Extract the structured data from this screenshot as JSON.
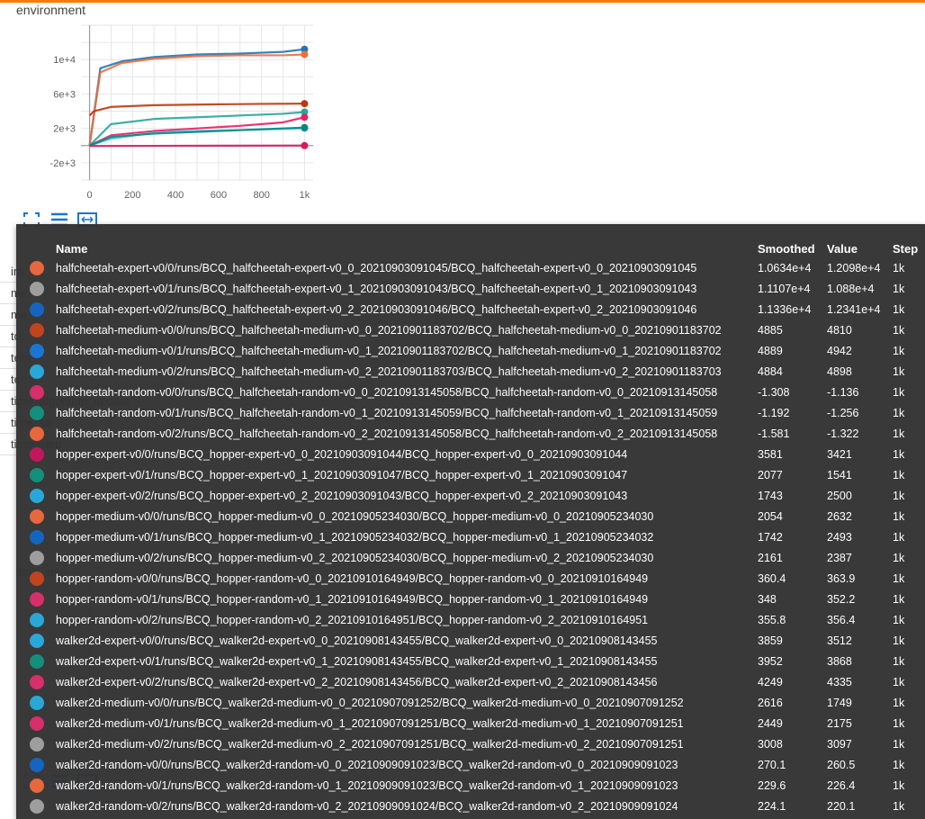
{
  "chart_data": {
    "type": "line",
    "title": "environment",
    "xlabel": "",
    "ylabel": "",
    "x_ticks": [
      "0",
      "200",
      "400",
      "600",
      "800",
      "1k"
    ],
    "y_ticks": [
      "-2e+3",
      "2e+3",
      "6e+3",
      "1e+4"
    ],
    "xlim": [
      -40,
      1040
    ],
    "ylim": [
      -4000,
      14000
    ],
    "grid": true,
    "series": [
      {
        "color": "#1f77b4",
        "values": [
          [
            0,
            0
          ],
          [
            50,
            9000
          ],
          [
            150,
            9800
          ],
          [
            300,
            10300
          ],
          [
            500,
            10600
          ],
          [
            700,
            10700
          ],
          [
            900,
            10900
          ],
          [
            1000,
            11200
          ]
        ]
      },
      {
        "color": "#ef6c3c",
        "values": [
          [
            0,
            0
          ],
          [
            50,
            8500
          ],
          [
            150,
            9600
          ],
          [
            300,
            10100
          ],
          [
            500,
            10400
          ],
          [
            700,
            10500
          ],
          [
            900,
            10500
          ],
          [
            1000,
            10600
          ]
        ]
      },
      {
        "color": "#bf360c",
        "values": [
          [
            0,
            3500
          ],
          [
            20,
            4000
          ],
          [
            100,
            4500
          ],
          [
            300,
            4700
          ],
          [
            600,
            4800
          ],
          [
            800,
            4850
          ],
          [
            1000,
            4880
          ]
        ]
      },
      {
        "color": "#26a69a",
        "values": [
          [
            0,
            0
          ],
          [
            100,
            2500
          ],
          [
            300,
            3100
          ],
          [
            500,
            3300
          ],
          [
            700,
            3500
          ],
          [
            900,
            3700
          ],
          [
            1000,
            3900
          ]
        ]
      },
      {
        "color": "#e91e63",
        "values": [
          [
            0,
            0
          ],
          [
            100,
            1200
          ],
          [
            300,
            1700
          ],
          [
            500,
            2000
          ],
          [
            700,
            2300
          ],
          [
            900,
            2700
          ],
          [
            1000,
            3300
          ]
        ]
      },
      {
        "color": "#4fc3f7",
        "values": [
          [
            0,
            0
          ],
          [
            100,
            800
          ],
          [
            300,
            1500
          ],
          [
            500,
            1700
          ],
          [
            700,
            1800
          ],
          [
            1000,
            2000
          ]
        ]
      },
      {
        "color": "#00897b",
        "values": [
          [
            0,
            0
          ],
          [
            100,
            1000
          ],
          [
            300,
            1400
          ],
          [
            500,
            1600
          ],
          [
            700,
            1800
          ],
          [
            1000,
            2100
          ]
        ]
      },
      {
        "color": "#d81b60",
        "values": [
          [
            0,
            -50
          ],
          [
            300,
            -30
          ],
          [
            600,
            -10
          ],
          [
            1000,
            -1
          ]
        ]
      }
    ]
  },
  "background": {
    "run_rows": [
      "im",
      "me",
      "me",
      "td",
      "tem",
      "ter",
      "time_algorithm_update",
      "time_sa",
      "time_step"
    ],
    "section_label": "time_step"
  },
  "tooltip": {
    "headers": {
      "name": "Name",
      "smoothed": "Smoothed",
      "value": "Value",
      "step": "Step"
    },
    "rows": [
      {
        "color": "#e8673c",
        "name": "halfcheetah-expert-v0/0/runs/BCQ_halfcheetah-expert-v0_0_20210903091045/BCQ_halfcheetah-expert-v0_0_20210903091045",
        "smoothed": "1.0634e+4",
        "value": "1.2098e+4",
        "step": "1k"
      },
      {
        "color": "#9e9e9e",
        "name": "halfcheetah-expert-v0/1/runs/BCQ_halfcheetah-expert-v0_1_20210903091043/BCQ_halfcheetah-expert-v0_1_20210903091043",
        "smoothed": "1.1107e+4",
        "value": "1.088e+4",
        "step": "1k"
      },
      {
        "color": "#1565c0",
        "name": "halfcheetah-expert-v0/2/runs/BCQ_halfcheetah-expert-v0_2_20210903091046/BCQ_halfcheetah-expert-v0_2_20210903091046",
        "smoothed": "1.1336e+4",
        "value": "1.2341e+4",
        "step": "1k"
      },
      {
        "color": "#c1441e",
        "name": "halfcheetah-medium-v0/0/runs/BCQ_halfcheetah-medium-v0_0_20210901183702/BCQ_halfcheetah-medium-v0_0_20210901183702",
        "smoothed": "4885",
        "value": "4810",
        "step": "1k"
      },
      {
        "color": "#1976d2",
        "name": "halfcheetah-medium-v0/1/runs/BCQ_halfcheetah-medium-v0_1_20210901183702/BCQ_halfcheetah-medium-v0_1_20210901183702",
        "smoothed": "4889",
        "value": "4942",
        "step": "1k"
      },
      {
        "color": "#29a8d8",
        "name": "halfcheetah-medium-v0/2/runs/BCQ_halfcheetah-medium-v0_2_20210901183703/BCQ_halfcheetah-medium-v0_2_20210901183703",
        "smoothed": "4884",
        "value": "4898",
        "step": "1k"
      },
      {
        "color": "#d62f6b",
        "name": "halfcheetah-random-v0/0/runs/BCQ_halfcheetah-random-v0_0_20210913145058/BCQ_halfcheetah-random-v0_0_20210913145058",
        "smoothed": "-1.308",
        "value": "-1.136",
        "step": "1k"
      },
      {
        "color": "#138f7c",
        "name": "halfcheetah-random-v0/1/runs/BCQ_halfcheetah-random-v0_1_20210913145059/BCQ_halfcheetah-random-v0_1_20210913145059",
        "smoothed": "-1.192",
        "value": "-1.256",
        "step": "1k"
      },
      {
        "color": "#e8673c",
        "name": "halfcheetah-random-v0/2/runs/BCQ_halfcheetah-random-v0_2_20210913145058/BCQ_halfcheetah-random-v0_2_20210913145058",
        "smoothed": "-1.581",
        "value": "-1.322",
        "step": "1k"
      },
      {
        "color": "#c2185b",
        "name": "hopper-expert-v0/0/runs/BCQ_hopper-expert-v0_0_20210903091044/BCQ_hopper-expert-v0_0_20210903091044",
        "smoothed": "3581",
        "value": "3421",
        "step": "1k"
      },
      {
        "color": "#138f7c",
        "name": "hopper-expert-v0/1/runs/BCQ_hopper-expert-v0_1_20210903091047/BCQ_hopper-expert-v0_1_20210903091047",
        "smoothed": "2077",
        "value": "1541",
        "step": "1k"
      },
      {
        "color": "#29a8d8",
        "name": "hopper-expert-v0/2/runs/BCQ_hopper-expert-v0_2_20210903091043/BCQ_hopper-expert-v0_2_20210903091043",
        "smoothed": "1743",
        "value": "2500",
        "step": "1k"
      },
      {
        "color": "#e8673c",
        "name": "hopper-medium-v0/0/runs/BCQ_hopper-medium-v0_0_20210905234030/BCQ_hopper-medium-v0_0_20210905234030",
        "smoothed": "2054",
        "value": "2632",
        "step": "1k"
      },
      {
        "color": "#1565c0",
        "name": "hopper-medium-v0/1/runs/BCQ_hopper-medium-v0_1_20210905234032/BCQ_hopper-medium-v0_1_20210905234032",
        "smoothed": "1742",
        "value": "2493",
        "step": "1k"
      },
      {
        "color": "#9e9e9e",
        "name": "hopper-medium-v0/2/runs/BCQ_hopper-medium-v0_2_20210905234030/BCQ_hopper-medium-v0_2_20210905234030",
        "smoothed": "2161",
        "value": "2387",
        "step": "1k"
      },
      {
        "color": "#c1441e",
        "name": "hopper-random-v0/0/runs/BCQ_hopper-random-v0_0_20210910164949/BCQ_hopper-random-v0_0_20210910164949",
        "smoothed": "360.4",
        "value": "363.9",
        "step": "1k"
      },
      {
        "color": "#d62f6b",
        "name": "hopper-random-v0/1/runs/BCQ_hopper-random-v0_1_20210910164949/BCQ_hopper-random-v0_1_20210910164949",
        "smoothed": "348",
        "value": "352.2",
        "step": "1k"
      },
      {
        "color": "#29a8d8",
        "name": "hopper-random-v0/2/runs/BCQ_hopper-random-v0_2_20210910164951/BCQ_hopper-random-v0_2_20210910164951",
        "smoothed": "355.8",
        "value": "356.4",
        "step": "1k"
      },
      {
        "color": "#29a8d8",
        "name": "walker2d-expert-v0/0/runs/BCQ_walker2d-expert-v0_0_20210908143455/BCQ_walker2d-expert-v0_0_20210908143455",
        "smoothed": "3859",
        "value": "3512",
        "step": "1k"
      },
      {
        "color": "#138f7c",
        "name": "walker2d-expert-v0/1/runs/BCQ_walker2d-expert-v0_1_20210908143455/BCQ_walker2d-expert-v0_1_20210908143455",
        "smoothed": "3952",
        "value": "3868",
        "step": "1k"
      },
      {
        "color": "#d62f6b",
        "name": "walker2d-expert-v0/2/runs/BCQ_walker2d-expert-v0_2_20210908143456/BCQ_walker2d-expert-v0_2_20210908143456",
        "smoothed": "4249",
        "value": "4335",
        "step": "1k"
      },
      {
        "color": "#29a8d8",
        "name": "walker2d-medium-v0/0/runs/BCQ_walker2d-medium-v0_0_20210907091252/BCQ_walker2d-medium-v0_0_20210907091252",
        "smoothed": "2616",
        "value": "1749",
        "step": "1k"
      },
      {
        "color": "#d62f6b",
        "name": "walker2d-medium-v0/1/runs/BCQ_walker2d-medium-v0_1_20210907091251/BCQ_walker2d-medium-v0_1_20210907091251",
        "smoothed": "2449",
        "value": "2175",
        "step": "1k"
      },
      {
        "color": "#9e9e9e",
        "name": "walker2d-medium-v0/2/runs/BCQ_walker2d-medium-v0_2_20210907091251/BCQ_walker2d-medium-v0_2_20210907091251",
        "smoothed": "3008",
        "value": "3097",
        "step": "1k"
      },
      {
        "color": "#1565c0",
        "name": "walker2d-random-v0/0/runs/BCQ_walker2d-random-v0_0_20210909091023/BCQ_walker2d-random-v0_0_20210909091023",
        "smoothed": "270.1",
        "value": "260.5",
        "step": "1k"
      },
      {
        "color": "#e8673c",
        "name": "walker2d-random-v0/1/runs/BCQ_walker2d-random-v0_1_20210909091023/BCQ_walker2d-random-v0_1_20210909091023",
        "smoothed": "229.6",
        "value": "226.4",
        "step": "1k"
      },
      {
        "color": "#9e9e9e",
        "name": "walker2d-random-v0/2/runs/BCQ_walker2d-random-v0_2_20210909091024/BCQ_walker2d-random-v0_2_20210909091024",
        "smoothed": "224.1",
        "value": "220.1",
        "step": "1k"
      }
    ]
  }
}
